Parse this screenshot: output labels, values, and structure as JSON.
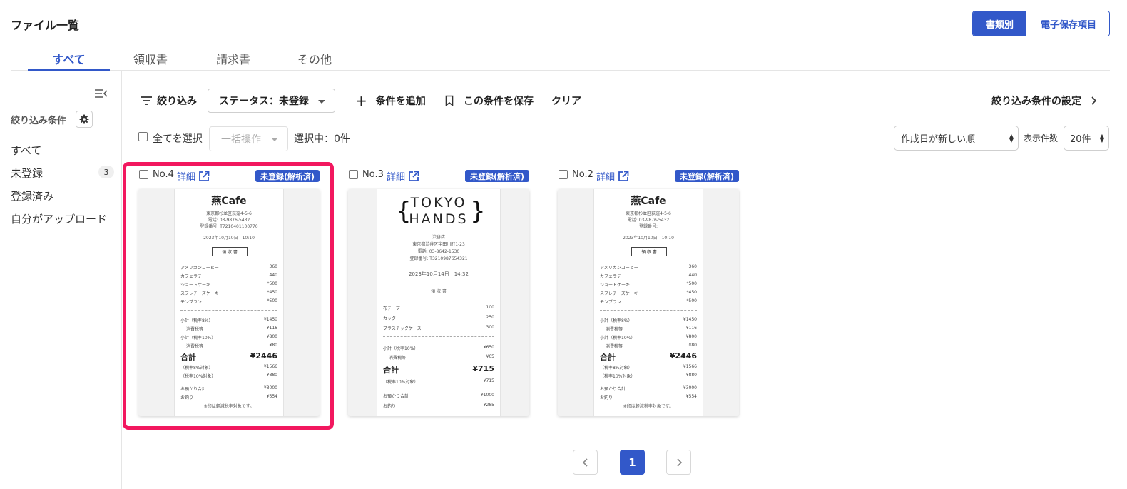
{
  "header": {
    "title": "ファイル一覧",
    "view_toggle": {
      "active": "書類別",
      "inactive": "電子保存項目"
    }
  },
  "tabs": [
    {
      "label": "すべて",
      "active": true
    },
    {
      "label": "領収書",
      "active": false
    },
    {
      "label": "請求書",
      "active": false
    },
    {
      "label": "その他",
      "active": false
    }
  ],
  "sidebar": {
    "filter_title": "絞り込み条件",
    "items": [
      {
        "label": "すべて"
      },
      {
        "label": "未登録",
        "count": "3"
      },
      {
        "label": "登録済み"
      },
      {
        "label": "自分がアップロード"
      }
    ]
  },
  "toolbar": {
    "filter_label": "絞り込み",
    "status_filter": "ステータス：未登録",
    "add_condition": "条件を追加",
    "save_condition": "この条件を保存",
    "clear": "クリア",
    "filter_settings": "絞り込み条件の設定"
  },
  "selection": {
    "select_all": "全てを選択",
    "bulk_action": "一括操作",
    "selected_count": "選択中：0件",
    "sort_value": "作成日が新しい順",
    "per_page_label": "表示件数",
    "per_page_value": "20件"
  },
  "cards": [
    {
      "no": "No.4",
      "detail": "詳細",
      "status": "未登録(解析済)",
      "selected": true,
      "receipt": {
        "shop": "燕Cafe",
        "address": [
          "東京都杉並区荻窪4-5-6",
          "電話: 03-9876-5432",
          "登録番号: T7210401100770"
        ],
        "date": "2023年10月10日　10:10",
        "doc_label": "領 収 書",
        "items": [
          [
            "アメリカンコーヒー",
            "360"
          ],
          [
            "カフェラテ",
            "440"
          ],
          [
            "ショートケーキ",
            "*500"
          ],
          [
            "スフレチーズケーキ",
            "*450"
          ],
          [
            "モンブラン",
            "*500"
          ]
        ],
        "subtotals": [
          [
            "小計（税率8%）",
            "¥1450"
          ],
          [
            "消費税等",
            "¥116"
          ],
          [
            "小計（税率10%）",
            "¥800"
          ],
          [
            "消費税等",
            "¥80"
          ]
        ],
        "total_label": "合計",
        "total": "¥2446",
        "breakdown": [
          [
            "（税率8%対象）",
            "¥1566"
          ],
          [
            "（税率10%対象）",
            "¥880"
          ]
        ],
        "payment": [
          [
            "お預かり合計",
            "¥3000"
          ],
          [
            "お釣り",
            "¥554"
          ]
        ],
        "note": "※印は軽減税率対象です。"
      }
    },
    {
      "no": "No.3",
      "detail": "詳細",
      "status": "未登録(解析済)",
      "selected": false,
      "receipt": {
        "logo_lines": [
          "TOKYO",
          "HANDS"
        ],
        "address": [
          "渋谷店",
          "東京都渋谷区宇田川町1-23",
          "電話: 03-8642-1530",
          "登録番号: T3210987654321"
        ],
        "date": "2023年10月14日　14:32",
        "doc_label": "領 収 書",
        "items": [
          [
            "布テープ",
            "100"
          ],
          [
            "カッター",
            "250"
          ],
          [
            "プラスチックケース",
            "300"
          ]
        ],
        "subtotals": [
          [
            "小計（税率10%）",
            "¥650"
          ],
          [
            "消費税等",
            "¥65"
          ]
        ],
        "total_label": "合計",
        "total": "¥715",
        "breakdown": [
          [
            "（税率10%対象）",
            "¥715"
          ]
        ],
        "payment": [
          [
            "お預かり合計",
            "¥1000"
          ],
          [
            "お釣り",
            "¥285"
          ]
        ]
      }
    },
    {
      "no": "No.2",
      "detail": "詳細",
      "status": "未登録(解析済)",
      "selected": false,
      "receipt": {
        "shop": "燕Cafe",
        "address": [
          "東京都杉並区荻窪4-5-6",
          "電話: 03-9876-5432",
          "登録番号:"
        ],
        "date": "2023年10月10日　10:10",
        "doc_label": "領 収 書",
        "items": [
          [
            "アメリカンコーヒー",
            "360"
          ],
          [
            "カフェラテ",
            "440"
          ],
          [
            "ショートケーキ",
            "*500"
          ],
          [
            "スフレチーズケーキ",
            "*450"
          ],
          [
            "モンブラン",
            "*500"
          ]
        ],
        "subtotals": [
          [
            "小計（税率8%）",
            "¥1450"
          ],
          [
            "消費税等",
            "¥116"
          ],
          [
            "小計（税率10%）",
            "¥800"
          ],
          [
            "消費税等",
            "¥80"
          ]
        ],
        "total_label": "合計",
        "total": "¥2446",
        "breakdown": [
          [
            "（税率8%対象）",
            "¥1566"
          ],
          [
            "（税率10%対象）",
            "¥880"
          ]
        ],
        "payment": [
          [
            "お預かり合計",
            "¥3000"
          ],
          [
            "お釣り",
            "¥554"
          ]
        ],
        "note": "※印は軽減税率対象です。"
      }
    }
  ],
  "pagination": {
    "current": "1"
  },
  "colors": {
    "accent": "#3258c9",
    "selection": "#f2185f"
  }
}
